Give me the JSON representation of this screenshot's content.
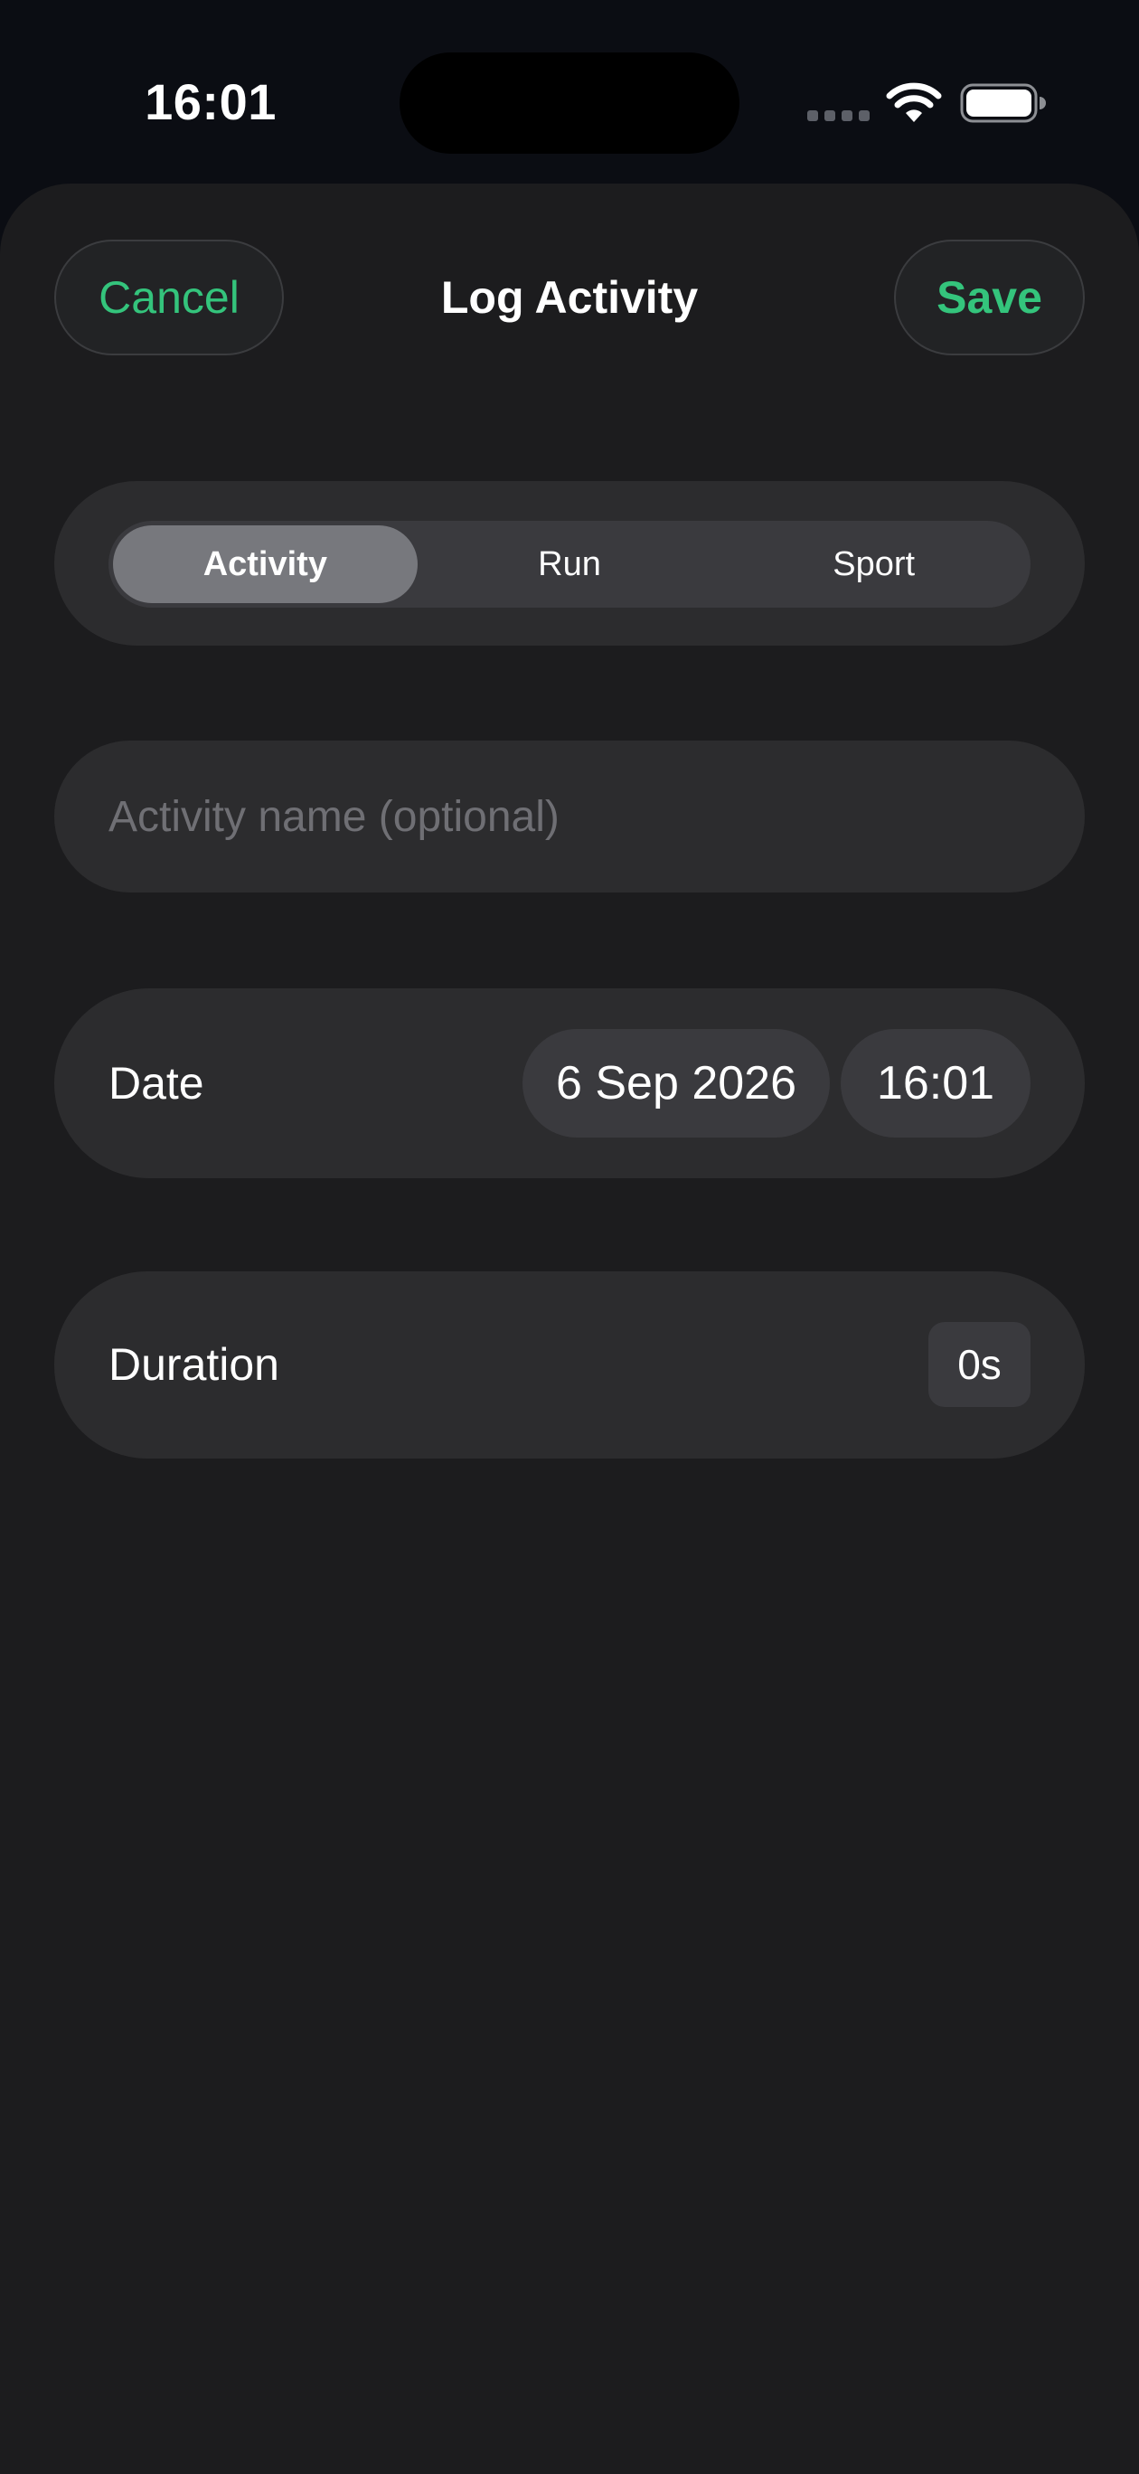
{
  "status_bar": {
    "time": "16:01",
    "icons": [
      "signal-icon",
      "wifi-icon",
      "battery-icon"
    ]
  },
  "header": {
    "cancel_label": "Cancel",
    "title": "Log Activity",
    "save_label": "Save"
  },
  "segments": [
    {
      "label": "Activity",
      "selected": true
    },
    {
      "label": "Run",
      "selected": false
    },
    {
      "label": "Sport",
      "selected": false
    }
  ],
  "name_field": {
    "placeholder": "Activity name (optional)",
    "value": ""
  },
  "date_row": {
    "label": "Date",
    "date_value": "6 Sep 2026",
    "time_value": "16:01"
  },
  "duration_row": {
    "label": "Duration",
    "value": "0s"
  },
  "colors": {
    "accent": "#34c47c",
    "background": "#1c1c1e",
    "card": "#2c2c2e",
    "chip": "#3a3a3e"
  }
}
